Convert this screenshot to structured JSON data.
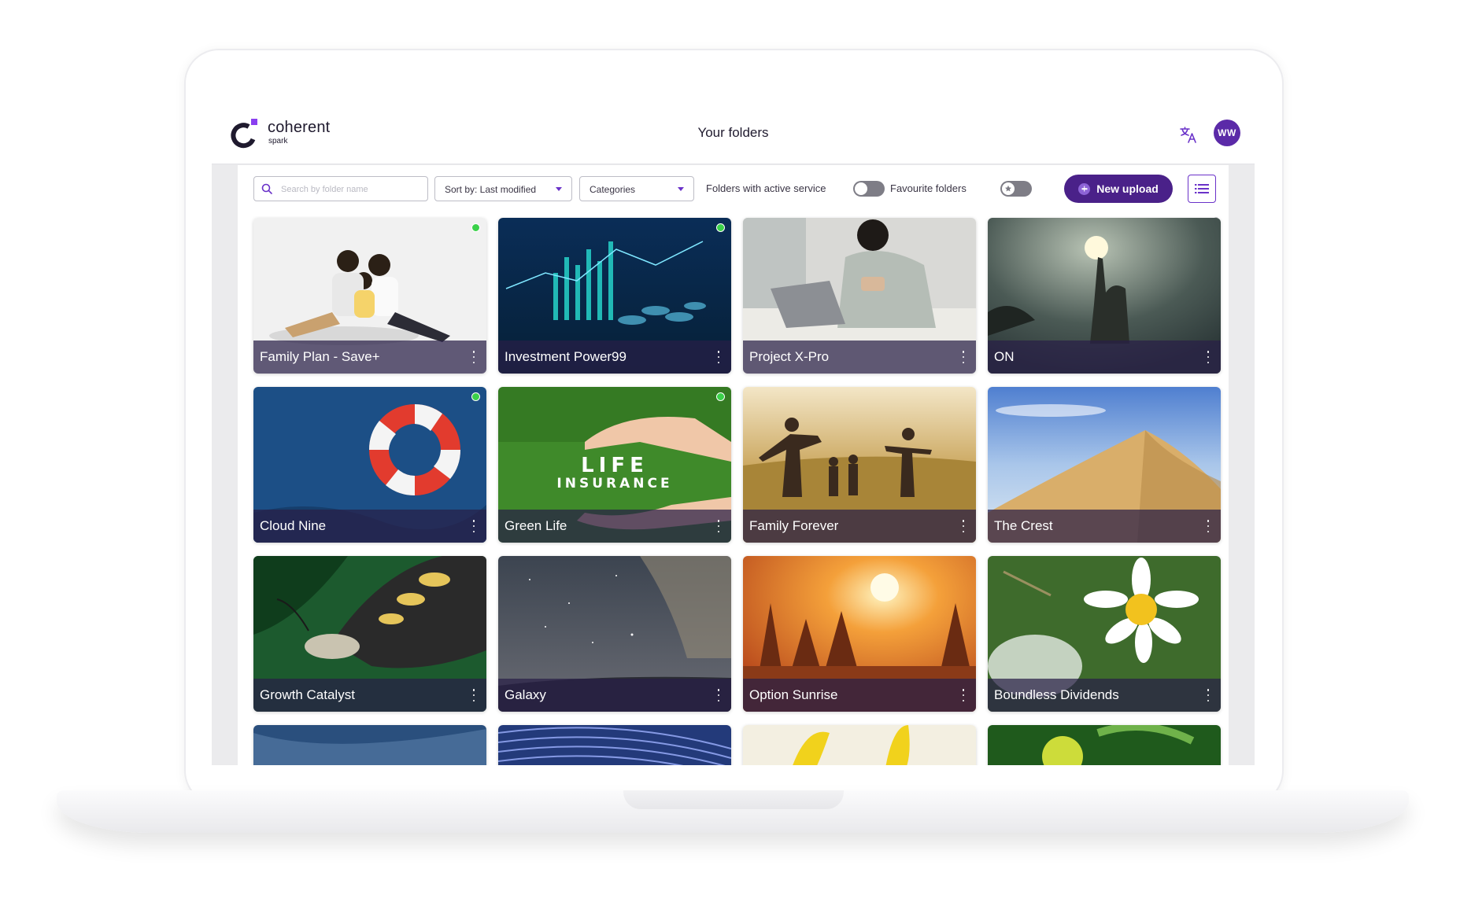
{
  "header": {
    "logo_word": "coherent",
    "logo_sub": "spark",
    "title": "Your folders",
    "avatar_initials": "WW",
    "translate_icon": "translate-icon"
  },
  "toolbar": {
    "search_placeholder": "Search by folder name",
    "search_value": "",
    "sort_label": "Sort by: Last modified",
    "categories_label": "Categories",
    "active_service_label": "Folders with active service",
    "active_service_on": false,
    "favourite_label": "Favourite folders",
    "favourite_on": false,
    "new_upload_label": "New upload",
    "view_icon": "list-view-icon"
  },
  "colors": {
    "brand_purple": "#4a2189",
    "accent_purple": "#6a32c9",
    "active_dot": "#3bd14a"
  },
  "folders": [
    {
      "title": "Family Plan - Save+",
      "active": true
    },
    {
      "title": "Investment Power99",
      "active": true
    },
    {
      "title": "Project X-Pro",
      "active": false
    },
    {
      "title": "ON",
      "active": false
    },
    {
      "title": "Cloud Nine",
      "active": true
    },
    {
      "title": "Green Life",
      "active": true
    },
    {
      "title": "Family Forever",
      "active": false
    },
    {
      "title": "The Crest",
      "active": false
    },
    {
      "title": "Growth Catalyst",
      "active": false
    },
    {
      "title": "Galaxy",
      "active": false
    },
    {
      "title": "Option Sunrise",
      "active": false
    },
    {
      "title": "Boundless Dividends",
      "active": false
    },
    {
      "title": "",
      "active": false
    },
    {
      "title": "",
      "active": false
    },
    {
      "title": "",
      "active": false
    },
    {
      "title": "",
      "active": false
    }
  ],
  "image_text": {
    "green_life_line1": "LIFE",
    "green_life_line2": "INSURANCE"
  }
}
